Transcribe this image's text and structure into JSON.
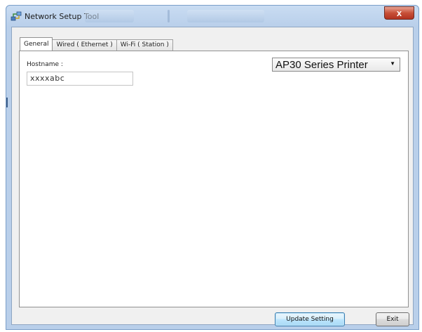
{
  "window": {
    "title": "Network Setup Tool",
    "close_label": "x"
  },
  "tabs": [
    {
      "label": "General",
      "active": true
    },
    {
      "label": "Wired ( Ethernet )",
      "active": false
    },
    {
      "label": "Wi-Fi ( Station )",
      "active": false
    }
  ],
  "general": {
    "hostname_label": "Hostname :",
    "hostname_value": "xxxxabc",
    "printer_selected": "AP30 Series Printer"
  },
  "buttons": {
    "update_label": "Update Setting",
    "exit_label": "Exit"
  },
  "colors": {
    "title_bar": "#b9cfea",
    "close_button": "#c75038",
    "default_button_border": "#3c7fb1"
  },
  "icons": {
    "app": "network-setup-icon",
    "dropdown": "dropdown-arrow-icon"
  }
}
